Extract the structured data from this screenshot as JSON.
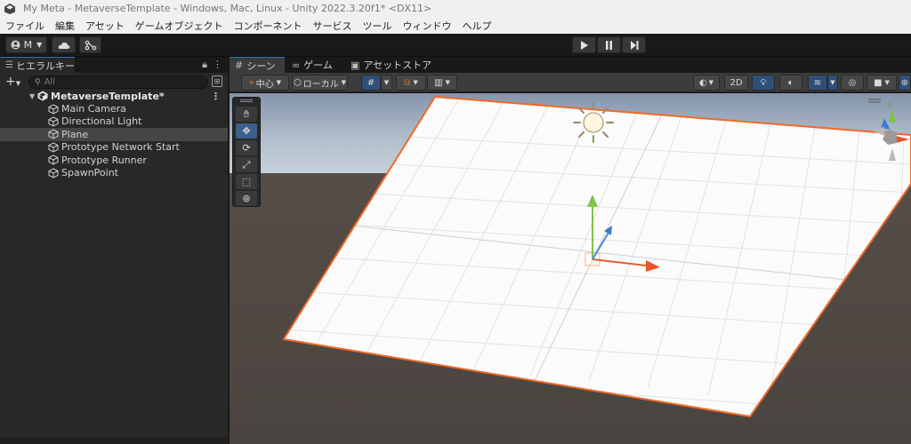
{
  "window": {
    "title": "My Meta - MetaverseTemplate - Windows, Mac, Linux - Unity 2022.3.20f1* <DX11>"
  },
  "menu": [
    "ファイル",
    "編集",
    "アセット",
    "ゲームオブジェクト",
    "コンポーネント",
    "サービス",
    "ツール",
    "ウィンドウ",
    "ヘルプ"
  ],
  "toolbar": {
    "account_label": "M"
  },
  "hierarchy": {
    "tab_label": "ヒエラルキー",
    "search_placeholder": "All",
    "root": "MetaverseTemplate*",
    "items": [
      "Main Camera",
      "Directional Light",
      "Plane",
      "Prototype Network Start",
      "Prototype Runner",
      "SpawnPoint"
    ],
    "selected": "Plane"
  },
  "scene": {
    "tabs": [
      "シーン",
      "ゲーム",
      "アセットストア"
    ],
    "pivot_label": "中心",
    "space_label": "ローカル",
    "mode_2d": "2D"
  },
  "colors": {
    "accent": "#3a72b0",
    "selection_outline": "#f06a28"
  }
}
